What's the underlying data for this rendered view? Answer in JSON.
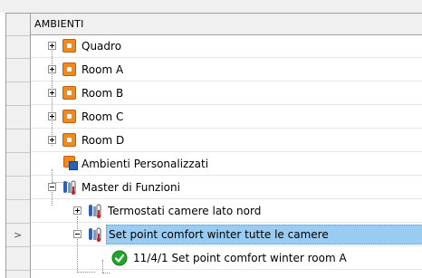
{
  "column_header": "AMBIENTI",
  "current_row_marker": ">",
  "tree": {
    "items": [
      {
        "label": "Quadro",
        "icon": "room-icon"
      },
      {
        "label": "Room A",
        "icon": "room-icon"
      },
      {
        "label": "Room B",
        "icon": "room-icon"
      },
      {
        "label": "Room C",
        "icon": "room-icon"
      },
      {
        "label": "Room D",
        "icon": "room-icon"
      },
      {
        "label": "Ambienti Personalizzati",
        "icon": "custom-room-icon"
      },
      {
        "label": "Master di Funzioni",
        "icon": "thermostat-group-icon"
      },
      {
        "label": "Termostati camere lato nord",
        "icon": "thermostat-group-icon"
      },
      {
        "label": "Set point comfort winter tutte le camere",
        "icon": "thermostat-group-icon",
        "selected": true
      },
      {
        "label": "11/4/1 Set point comfort winter room A",
        "icon": "check-icon"
      }
    ]
  },
  "colors": {
    "room_orange": "#f08a1e",
    "selection_blue": "#99ccf0",
    "check_green": "#22a52a",
    "header_gray": "#f0f0f0"
  }
}
